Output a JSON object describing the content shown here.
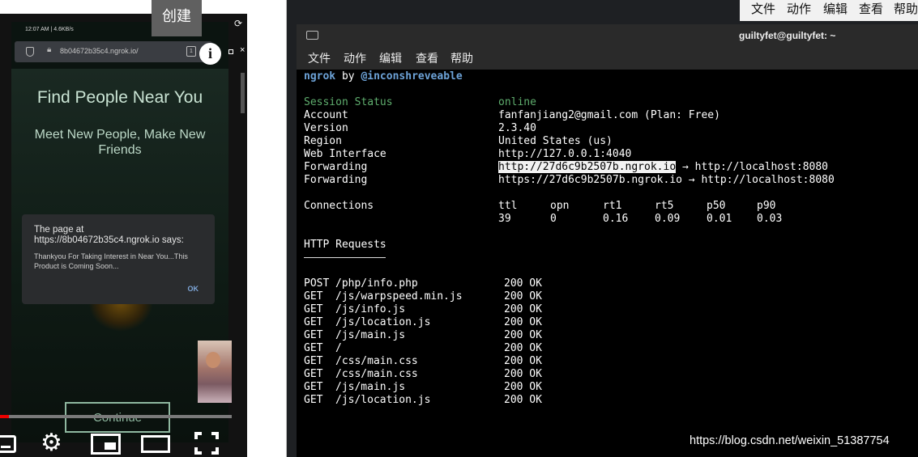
{
  "tooltip": {
    "label": "创建"
  },
  "phone": {
    "status_time": "12:07 AM | 4.6KB/s",
    "url": "8b04672b35c4.ngrok.io/",
    "tab_count": "1",
    "hero_title": "Find People Near You",
    "hero_subtitle": "Meet New People, Make New Friends",
    "dialog": {
      "title": "The page at https://8b04672b35c4.ngrok.io says:",
      "message": "Thankyou For Taking Interest in Near You...This Product is Coming Soon...",
      "ok_label": "OK"
    },
    "continue_label": "Continue"
  },
  "player": {
    "progress": 0.04,
    "icons": [
      "subtitles-icon",
      "settings-icon",
      "miniplayer-icon",
      "theater-icon",
      "fullscreen-icon"
    ]
  },
  "background_window": {
    "menu": [
      "文件",
      "动作",
      "编辑",
      "查看",
      "帮助"
    ]
  },
  "terminal": {
    "title": "guiltyfet@guiltyfet: ~",
    "menu": [
      "文件",
      "动作",
      "编辑",
      "查看",
      "帮助"
    ],
    "header_app": "ngrok",
    "header_by": "by",
    "header_author": "@inconshreveable",
    "fields": [
      {
        "label": "Session Status",
        "value": "online"
      },
      {
        "label": "Account",
        "value": "fanfanjiang2@gmail.com (Plan: Free)"
      },
      {
        "label": "Version",
        "value": "2.3.40"
      },
      {
        "label": "Region",
        "value": "United States (us)"
      },
      {
        "label": "Web Interface",
        "value": "http://127.0.0.1:4040"
      },
      {
        "label": "Forwarding",
        "value_url": "http://27d6c9b2507b.ngrok.io",
        "value_target": " → http://localhost:8080"
      },
      {
        "label": "Forwarding",
        "value": "https://27d6c9b2507b.ngrok.io → http://localhost:8080"
      }
    ],
    "connections": {
      "label": "Connections",
      "headers": [
        "ttl",
        "opn",
        "rt1",
        "rt5",
        "p50",
        "p90"
      ],
      "values": [
        "39",
        "0",
        "0.16",
        "0.09",
        "0.01",
        "0.03"
      ]
    },
    "http_title": "HTTP Requests",
    "requests": [
      {
        "method": "POST",
        "path": "/php/info.php",
        "status": "200 OK"
      },
      {
        "method": "GET",
        "path": "/js/warpspeed.min.js",
        "status": "200 OK"
      },
      {
        "method": "GET",
        "path": "/js/info.js",
        "status": "200 OK"
      },
      {
        "method": "GET",
        "path": "/js/location.js",
        "status": "200 OK"
      },
      {
        "method": "GET",
        "path": "/js/main.js",
        "status": "200 OK"
      },
      {
        "method": "GET",
        "path": "/",
        "status": "200 OK"
      },
      {
        "method": "GET",
        "path": "/css/main.css",
        "status": "200 OK"
      },
      {
        "method": "GET",
        "path": "/css/main.css",
        "status": "200 OK"
      },
      {
        "method": "GET",
        "path": "/js/main.js",
        "status": "200 OK"
      },
      {
        "method": "GET",
        "path": "/js/location.js",
        "status": "200 OK"
      }
    ]
  },
  "watermark": "https://blog.csdn.net/weixin_51387754"
}
